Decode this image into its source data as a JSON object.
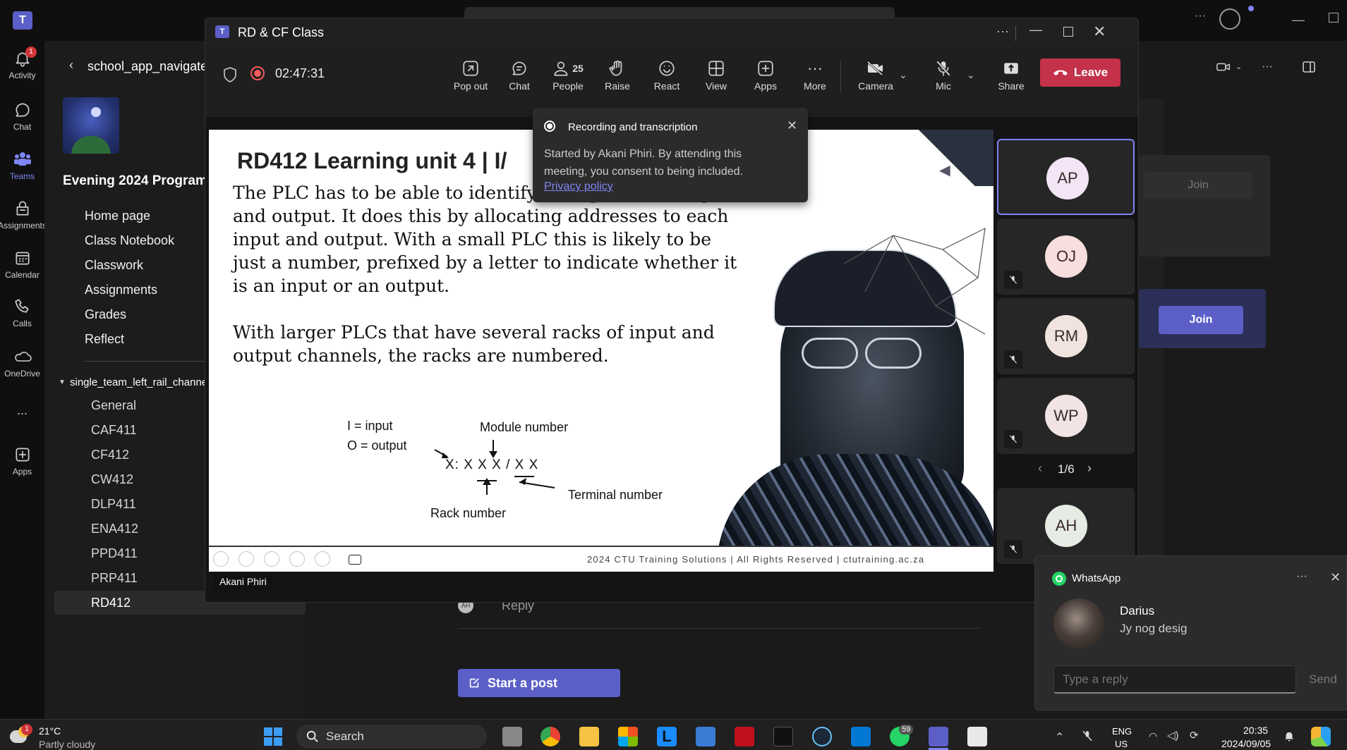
{
  "rail": {
    "items": [
      {
        "label": "Activity",
        "badge": "1"
      },
      {
        "label": "Chat"
      },
      {
        "label": "Teams"
      },
      {
        "label": "Assignments"
      },
      {
        "label": "Calendar"
      },
      {
        "label": "Calls"
      },
      {
        "label": "OneDrive"
      },
      {
        "label": "..."
      },
      {
        "label": "Apps"
      }
    ]
  },
  "leftpane": {
    "back_title": "school_app_navigate",
    "team_name": "Evening 2024 Program",
    "nav": [
      "Home page",
      "Class Notebook",
      "Classwork",
      "Assignments",
      "Grades",
      "Reflect"
    ],
    "channel_group": "single_team_left_rail_channel",
    "channels": [
      "General",
      "CAF411",
      "CF412",
      "CW412",
      "DLP411",
      "ENA412",
      "PPD411",
      "PRP411",
      "RD412"
    ]
  },
  "main": {
    "join_disabled": "Join",
    "join_button": "Join",
    "reply_label": "Reply",
    "start_post": "Start a post"
  },
  "meeting": {
    "title": "RD & CF Class",
    "timer": "02:47:31",
    "toolbar": [
      {
        "label": "Pop out",
        "icon": "pop-out-icon"
      },
      {
        "label": "Chat",
        "icon": "chat-icon"
      },
      {
        "label": "People",
        "icon": "people-icon",
        "count": "25"
      },
      {
        "label": "Raise",
        "icon": "raise-hand-icon"
      },
      {
        "label": "React",
        "icon": "react-icon"
      },
      {
        "label": "View",
        "icon": "view-icon"
      },
      {
        "label": "Apps",
        "icon": "apps-icon"
      },
      {
        "label": "More",
        "icon": "more-icon"
      },
      {
        "label": "Camera",
        "icon": "camera-off-icon"
      },
      {
        "label": "Mic",
        "icon": "mic-off-icon"
      },
      {
        "label": "Share",
        "icon": "share-icon"
      }
    ],
    "leave_label": "Leave",
    "recording_popup": {
      "title": "Recording and transcription",
      "body": "Started by Akani Phiri. By attending this meeting, you consent to being included.",
      "link": "Privacy policy"
    },
    "presenter_label": "Akani Phiri",
    "participants": [
      {
        "initials": "AP",
        "color": "#f3e5f5",
        "muted": false,
        "active": true
      },
      {
        "initials": "OJ",
        "color": "#f8dede",
        "muted": true
      },
      {
        "initials": "RM",
        "color": "#f1e4df",
        "muted": true
      },
      {
        "initials": "WP",
        "color": "#f2e4e4",
        "muted": true
      },
      {
        "initials": "AH",
        "color": "#e6ece3",
        "muted": true
      }
    ],
    "pager": "1/6"
  },
  "slide": {
    "title": "RD412 Learning unit 4 |  I/",
    "para1": [
      "The PLC has to be able to identify each particular input",
      "and output. It does this by allocating addresses to each",
      "input and output. With a small PLC this is likely to be",
      "just a number, prefixed by a letter to indicate whether it",
      "is an input or an output."
    ],
    "para2": [
      "With larger PLCs that have several racks of input and",
      "output channels, the racks are numbered."
    ],
    "diagram": {
      "i_label": "I = input",
      "o_label": "O = output",
      "module": "Module number",
      "address": "X: X X X / X X",
      "terminal": "Terminal number",
      "rack": "Rack number"
    },
    "footer": "2024 CTU Training Solutions  |  All Rights Reserved  |  ctutraining.ac.za"
  },
  "whatsapp": {
    "app": "WhatsApp",
    "sender": "Darius",
    "message": "Jy nog desig",
    "reply_placeholder": "Type a reply",
    "send": "Send"
  },
  "taskbar": {
    "weather_temp": "21°C",
    "weather_desc": "Partly cloudy",
    "weather_badge": "1",
    "search": "Search",
    "whatsapp_badge": "59",
    "lang1": "ENG",
    "lang2": "US",
    "time": "20:35",
    "date": "2024/09/05"
  }
}
